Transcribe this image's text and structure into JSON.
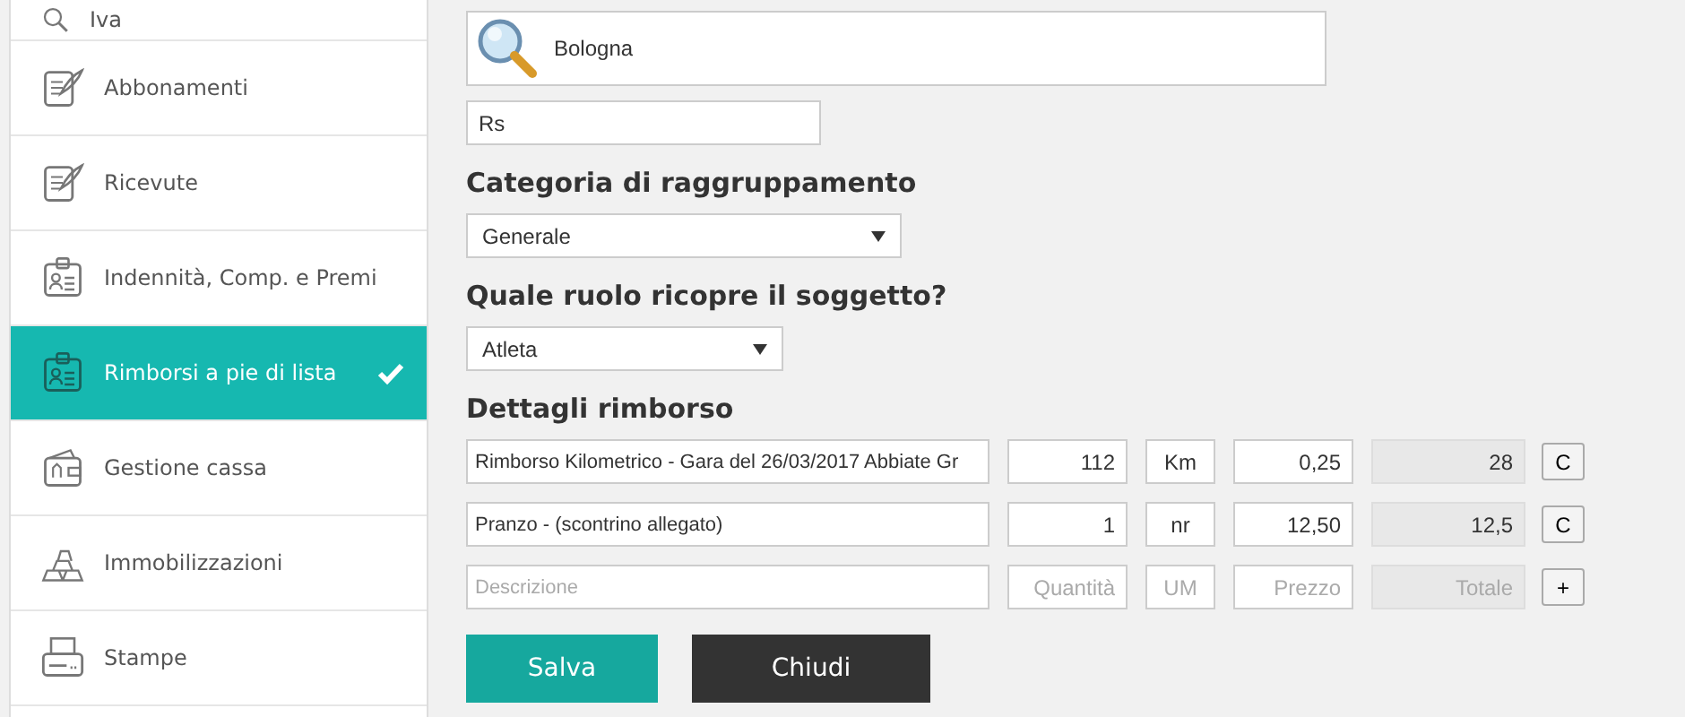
{
  "sidebar": {
    "items": [
      {
        "label": "Iva",
        "selected": false
      },
      {
        "label": "Abbonamenti",
        "selected": false
      },
      {
        "label": "Ricevute",
        "selected": false
      },
      {
        "label": "Indennità, Comp. e Premi",
        "selected": false
      },
      {
        "label": "Rimborsi a pie di lista",
        "selected": true
      },
      {
        "label": "Gestione cassa",
        "selected": false
      },
      {
        "label": "Immobilizzazioni",
        "selected": false
      },
      {
        "label": "Stampe",
        "selected": false
      }
    ]
  },
  "search": {
    "value": "Bologna"
  },
  "code_field": {
    "value": "Rs"
  },
  "grouping": {
    "heading": "Categoria di raggruppamento",
    "value": "Generale"
  },
  "role": {
    "heading": "Quale ruolo ricopre il soggetto?",
    "value": "Atleta"
  },
  "details": {
    "heading": "Dettagli rimborso",
    "rows": [
      {
        "cells": [
          {
            "value": "Rimborso Kilometrico - Gara del 26/03/2017 Abbiate Gr"
          },
          {
            "value": "112"
          },
          {
            "value": "Km"
          },
          {
            "value": "0,25"
          },
          {
            "value": "28"
          }
        ],
        "action": "C"
      },
      {
        "cells": [
          {
            "value": "Pranzo - (scontrino allegato)"
          },
          {
            "value": "1"
          },
          {
            "value": "nr"
          },
          {
            "value": "12,50"
          },
          {
            "value": "12,5"
          }
        ],
        "action": "C"
      },
      {
        "cells": [
          {
            "placeholder": "Descrizione"
          },
          {
            "placeholder": "Quantità"
          },
          {
            "placeholder": "UM"
          },
          {
            "placeholder": "Prezzo"
          },
          {
            "placeholder": "Totale"
          }
        ],
        "action": "+"
      }
    ]
  },
  "buttons": [
    {
      "label": "Salva",
      "kind": "primary"
    },
    {
      "label": "Chiudi",
      "kind": "dark"
    }
  ]
}
